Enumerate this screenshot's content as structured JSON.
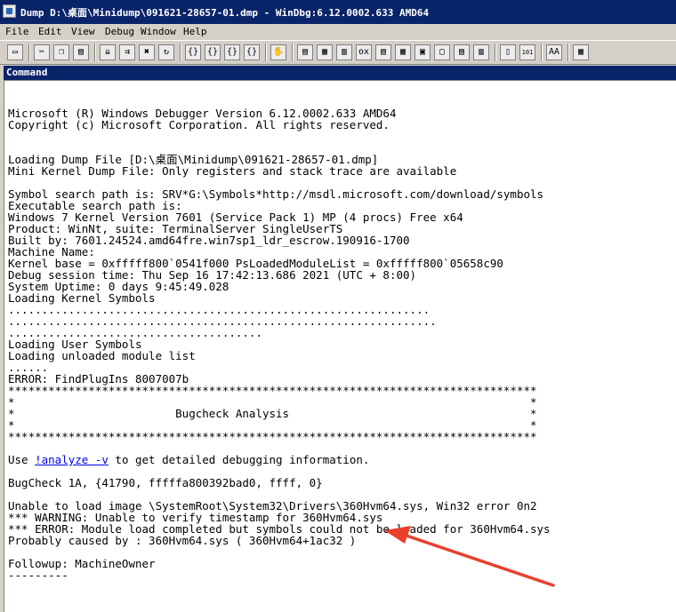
{
  "window": {
    "title": "Dump D:\\桌面\\Minidump\\091621-28657-01.dmp - WinDbg:6.12.0002.633 AMD64"
  },
  "menu": [
    "File",
    "Edit",
    "View",
    "Debug",
    "Window",
    "Help"
  ],
  "toolbar": [
    {
      "name": "open-icon",
      "glyph": "▭"
    },
    {
      "sep": true
    },
    {
      "name": "cut-icon",
      "glyph": "✂"
    },
    {
      "name": "copy-icon",
      "glyph": "❐"
    },
    {
      "name": "paste-icon",
      "glyph": "▤"
    },
    {
      "sep": true
    },
    {
      "name": "step-into-icon",
      "glyph": "⇊"
    },
    {
      "name": "step-over-icon",
      "glyph": "⇉"
    },
    {
      "name": "stop-icon",
      "glyph": "✖"
    },
    {
      "name": "restart-icon",
      "glyph": "↻"
    },
    {
      "sep": true
    },
    {
      "name": "step-in-source-icon",
      "glyph": "{}"
    },
    {
      "name": "step-over-source-icon",
      "glyph": "{}"
    },
    {
      "name": "step-out-icon",
      "glyph": "{}"
    },
    {
      "name": "run-to-cursor-icon",
      "glyph": "{}"
    },
    {
      "sep": true
    },
    {
      "name": "hand-icon",
      "glyph": "✋"
    },
    {
      "sep": true
    },
    {
      "name": "command-window-icon",
      "glyph": "▤"
    },
    {
      "name": "watch-window-icon",
      "glyph": "▦"
    },
    {
      "name": "locals-window-icon",
      "glyph": "▥"
    },
    {
      "name": "registers-window-icon",
      "glyph": "ox"
    },
    {
      "name": "memory-window-icon",
      "glyph": "▤"
    },
    {
      "name": "call-stack-window-icon",
      "glyph": "▦"
    },
    {
      "name": "disassembly-window-icon",
      "glyph": "▣"
    },
    {
      "name": "scratch-pad-icon",
      "glyph": "▢"
    },
    {
      "name": "processes-window-icon",
      "glyph": "▤"
    },
    {
      "name": "source-mode-icon",
      "glyph": "▥"
    },
    {
      "sep": true
    },
    {
      "name": "source-file-icon",
      "glyph": "▯"
    },
    {
      "name": "hex-mode-icon",
      "glyph": "101"
    },
    {
      "sep": true
    },
    {
      "name": "font-icon",
      "glyph": "AA"
    },
    {
      "sep": true
    },
    {
      "name": "options-icon",
      "glyph": "▦"
    }
  ],
  "command": {
    "header": "Command",
    "lines": [
      {
        "text": ""
      },
      {
        "text": "Microsoft (R) Windows Debugger Version 6.12.0002.633 AMD64"
      },
      {
        "text": "Copyright (c) Microsoft Corporation. All rights reserved."
      },
      {
        "text": ""
      },
      {
        "text": ""
      },
      {
        "text": "Loading Dump File [D:\\桌面\\Minidump\\091621-28657-01.dmp]"
      },
      {
        "text": "Mini Kernel Dump File: Only registers and stack trace are available"
      },
      {
        "text": ""
      },
      {
        "text": "Symbol search path is: SRV*G:\\Symbols*http://msdl.microsoft.com/download/symbols"
      },
      {
        "text": "Executable search path is:"
      },
      {
        "text": "Windows 7 Kernel Version 7601 (Service Pack 1) MP (4 procs) Free x64"
      },
      {
        "text": "Product: WinNt, suite: TerminalServer SingleUserTS"
      },
      {
        "text": "Built by: 7601.24524.amd64fre.win7sp1_ldr_escrow.190916-1700"
      },
      {
        "text": "Machine Name:"
      },
      {
        "text": "Kernel base = 0xfffff800`0541f000 PsLoadedModuleList = 0xfffff800`05658c90"
      },
      {
        "text": "Debug session time: Thu Sep 16 17:42:13.686 2021 (UTC + 8:00)"
      },
      {
        "text": "System Uptime: 0 days 9:45:49.028"
      },
      {
        "text": "Loading Kernel Symbols"
      },
      {
        "text": "..............................................................."
      },
      {
        "text": "................................................................"
      },
      {
        "text": "......................................"
      },
      {
        "text": "Loading User Symbols"
      },
      {
        "text": "Loading unloaded module list"
      },
      {
        "text": "......"
      },
      {
        "text": "ERROR: FindPlugIns 8007007b"
      },
      {
        "text": "*******************************************************************************"
      },
      {
        "text": "*                                                                             *"
      },
      {
        "text": "*                        Bugcheck Analysis                                    *"
      },
      {
        "text": "*                                                                             *"
      },
      {
        "text": "*******************************************************************************"
      },
      {
        "text": ""
      },
      {
        "pre": "Use ",
        "link": "!analyze -v",
        "post": " to get detailed debugging information."
      },
      {
        "text": ""
      },
      {
        "text": "BugCheck 1A, {41790, fffffa800392bad0, ffff, 0}"
      },
      {
        "text": ""
      },
      {
        "text": "Unable to load image \\SystemRoot\\System32\\Drivers\\360Hvm64.sys, Win32 error 0n2"
      },
      {
        "text": "*** WARNING: Unable to verify timestamp for 360Hvm64.sys"
      },
      {
        "text": "*** ERROR: Module load completed but symbols could not be loaded for 360Hvm64.sys"
      },
      {
        "text": "Probably caused by : 360Hvm64.sys ( 360Hvm64+1ac32 )"
      },
      {
        "text": ""
      },
      {
        "text": "Followup: MachineOwner"
      },
      {
        "text": "---------"
      }
    ]
  },
  "colors": {
    "titlebar": "#0a246a",
    "annotation_arrow": "#e8412e",
    "link": "#0000ee"
  }
}
